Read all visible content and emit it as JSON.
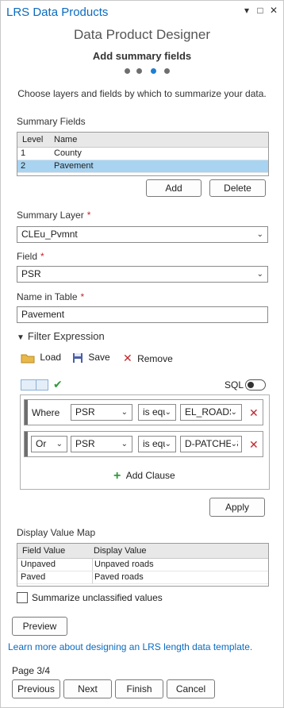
{
  "window": {
    "title": "LRS Data Products",
    "menu_glyph": "▾",
    "max_glyph": "□",
    "close_glyph": "✕"
  },
  "header": {
    "subtitle": "Data Product Designer",
    "step_title": "Add summary fields",
    "description": "Choose layers and fields by which to summarize your data."
  },
  "steps": {
    "count": 4,
    "active": 3
  },
  "summary_fields": {
    "label": "Summary Fields",
    "columns": [
      "Level",
      "Name"
    ],
    "rows": [
      {
        "level": "1",
        "name": "County",
        "selected": false
      },
      {
        "level": "2",
        "name": "Pavement",
        "selected": true
      }
    ],
    "add_label": "Add",
    "delete_label": "Delete"
  },
  "summary_layer": {
    "label": "Summary Layer",
    "value": "CLEu_Pvmnt"
  },
  "field": {
    "label": "Field",
    "value": "PSR"
  },
  "name_in_table": {
    "label": "Name in Table",
    "value": "Pavement"
  },
  "filter": {
    "label": "Filter Expression",
    "load_label": "Load",
    "save_label": "Save",
    "remove_label": "Remove",
    "sql_label": "SQL",
    "clauses": [
      {
        "connector": "Where",
        "field": "PSR",
        "operator": "is equ",
        "value": "EL_ROADS"
      },
      {
        "connector": "Or",
        "field": "PSR",
        "operator": "is equ",
        "value": "D-PATCHES"
      }
    ],
    "add_clause_label": "Add Clause",
    "apply_label": "Apply"
  },
  "display_value_map": {
    "label": "Display Value Map",
    "columns": [
      "Field Value",
      "Display Value"
    ],
    "rows": [
      {
        "field_value": "Unpaved",
        "display_value": "Unpaved roads"
      },
      {
        "field_value": "Paved",
        "display_value": "Paved roads"
      }
    ]
  },
  "summarize_unclassified": {
    "label": "Summarize unclassified values",
    "checked": false
  },
  "preview_label": "Preview",
  "learn_more": "Learn more about designing an LRS length data template.",
  "footer": {
    "page": "Page 3/4",
    "previous": "Previous",
    "next": "Next",
    "finish": "Finish",
    "cancel": "Cancel"
  },
  "colors": {
    "accent": "#0b6bc0",
    "selection": "#a8d4f2",
    "required": "#c4262e",
    "add_green": "#2e9a3a"
  }
}
